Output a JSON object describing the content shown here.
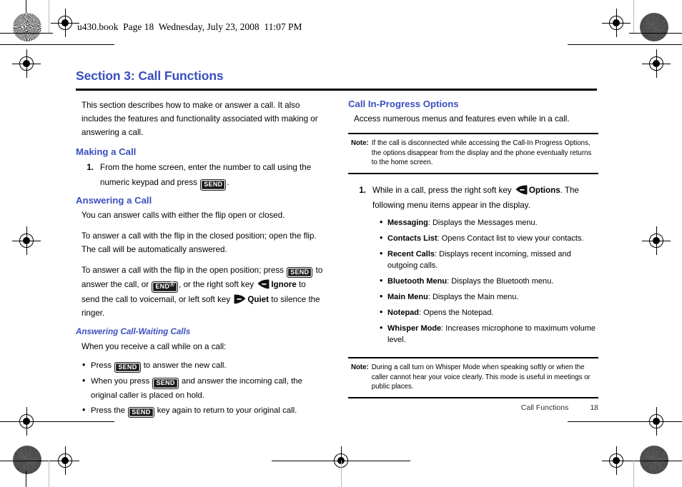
{
  "print_header": "u430.book  Page 18  Wednesday, July 23, 2008  11:07 PM",
  "accent_color": "#3a4fbf",
  "section": {
    "title": "Section 3: Call Functions"
  },
  "left_column": {
    "intro": "This section describes how to make or answer a call. It also includes the features and functionality associated with making or answering a call.",
    "making_a_call": {
      "heading": "Making a Call",
      "step_number": "1.",
      "step_text_before": "From the home screen, enter the number to call using the numeric keypad and press",
      "send_key": "SEND",
      "step_text_after": "."
    },
    "answering_a_call": {
      "heading": "Answering a Call",
      "para1": "You can answer calls with either the flip open or closed.",
      "para2": "To answer a call with the flip in the closed position; open the flip. The call will be automatically answered.",
      "para3_a": "To answer a call with the flip in the open position; press",
      "send_key": "SEND",
      "para3_b": "to answer the call, or",
      "end_key": "END",
      "end_key_sup": "Ⓐ",
      "para3_c": ", or the right soft key",
      "ignore_label": "Ignore",
      "para3_d": "to send the call to voicemail, or left soft key",
      "quiet_label": "Quiet",
      "para3_e": "to silence the ringer."
    },
    "call_waiting": {
      "heading": "Answering Call-Waiting Calls",
      "lead": "When you receive a call while on a call:",
      "bullets": [
        {
          "before": "Press",
          "key": "SEND",
          "after": "to answer the new call."
        },
        {
          "before": "When you press",
          "key": "SEND",
          "after": "and answer the incoming call, the original caller is placed on hold."
        },
        {
          "before": "Press the",
          "key": "SEND",
          "after": "key again to return to your original call."
        }
      ]
    }
  },
  "right_column": {
    "heading": "Call In-Progress Options",
    "intro": "Access numerous menus and features even while in a call.",
    "note_top": {
      "label": "Note:",
      "text": "If the call is disconnected while accessing the Call-In Progress Options, the options disappear from the display and the phone eventually returns to the home screen."
    },
    "step": {
      "number": "1.",
      "text_before": "While in a call, press the right soft key",
      "options_label": "Options",
      "text_after": ". The following menu items appear in the display."
    },
    "menu_items": [
      {
        "name": "Messaging",
        "desc": ": Displays the Messages menu."
      },
      {
        "name": "Contacts List",
        "desc": ": Opens Contact list to view your contacts."
      },
      {
        "name": "Recent Calls",
        "desc": ": Displays recent incoming, missed and outgoing calls."
      },
      {
        "name": "Bluetooth Menu",
        "desc": ": Displays the Bluetooth menu."
      },
      {
        "name": "Main Menu",
        "desc": ": Displays the Main menu."
      },
      {
        "name": "Notepad",
        "desc": ": Opens the Notepad."
      },
      {
        "name": "Whisper Mode",
        "desc": ": Increases microphone to maximum volume level."
      }
    ],
    "note_bottom": {
      "label": "Note:",
      "text": "During a call turn on Whisper Mode when speaking softly or when the caller cannot hear your voice clearly. This mode is useful in meetings or public places."
    }
  },
  "footer": {
    "section_name": "Call Functions",
    "page_number": "18"
  }
}
